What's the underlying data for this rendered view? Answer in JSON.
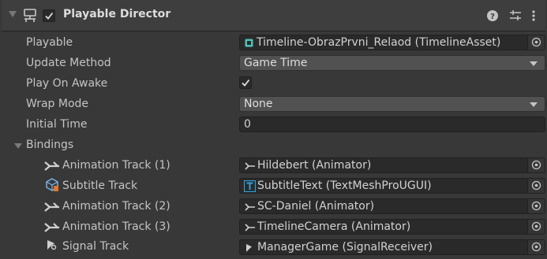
{
  "header": {
    "title": "Playable Director",
    "enabled": true,
    "icons": [
      "foldout-icon",
      "playable-director-icon",
      "help-icon",
      "presets-icon",
      "more-menu-icon"
    ]
  },
  "properties": {
    "playable": {
      "label": "Playable",
      "value": "Timeline-ObrazPrvni_Relaod (TimelineAsset)",
      "icon": "timeline-asset-icon"
    },
    "update_method": {
      "label": "Update Method",
      "value": "Game Time"
    },
    "play_on_awake": {
      "label": "Play On Awake",
      "checked": true
    },
    "wrap_mode": {
      "label": "Wrap Mode",
      "value": "None"
    },
    "initial_time": {
      "label": "Initial Time",
      "value": "0"
    }
  },
  "bindings": {
    "label": "Bindings",
    "expanded": true,
    "tracks": [
      {
        "label": "Animation Track (1)",
        "icon": "animation-track-icon",
        "value": "Hildebert (Animator)",
        "value_icon": "animator-icon"
      },
      {
        "label": "Subtitle Track",
        "icon": "subtitle-track-icon",
        "value": "SubtitleText (TextMeshProUGUI)",
        "value_icon": "textmeshpro-icon"
      },
      {
        "label": "Animation Track (2)",
        "icon": "animation-track-icon",
        "value": "SC-Daniel (Animator)",
        "value_icon": "animator-icon"
      },
      {
        "label": "Animation Track (3)",
        "icon": "animation-track-icon",
        "value": "TimelineCamera (Animator)",
        "value_icon": "animator-icon"
      },
      {
        "label": "Signal Track",
        "icon": "signal-track-icon",
        "value": "ManagerGame (SignalReceiver)",
        "value_icon": "signal-receiver-icon"
      }
    ]
  },
  "colors": {
    "background": "#383838",
    "header": "#3e3e3e",
    "field": "#2a2a2a",
    "dropdown": "#515151",
    "timeline_icon": "#4fc3b8",
    "tmp_icon": "#2fa0d8"
  }
}
